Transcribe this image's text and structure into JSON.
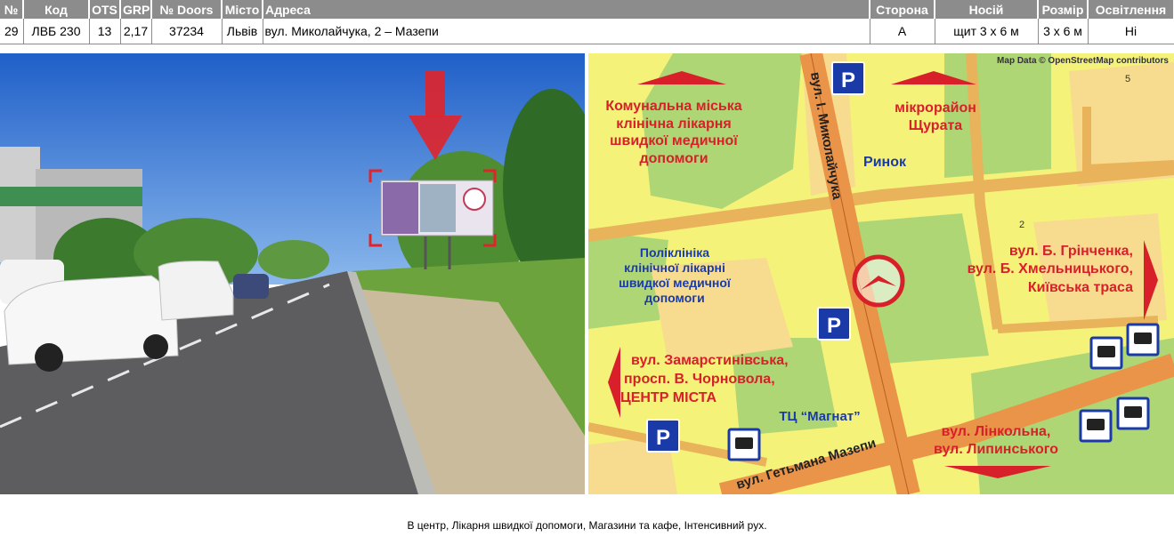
{
  "table": {
    "headers": [
      "№",
      "Код",
      "OTS",
      "GRP",
      "№ Doors",
      "Місто",
      "Адреса",
      "Сторона",
      "Носій",
      "Розмір",
      "Освітлення"
    ],
    "row": [
      "29",
      "ЛВБ 230",
      "13",
      "2,17",
      "37234",
      "Львів",
      "вул. Миколайчука, 2 – Мазепи",
      "A",
      "щит 3 х 6 м",
      "3 х 6 м",
      "Ні"
    ]
  },
  "map": {
    "attribution": "Map Data © OpenStreetMap contributors",
    "house_numbers": [
      "5",
      "2"
    ],
    "street_vertical": "вул. І. Миколайчука",
    "street_bottom": "вул. Гетьмана Мазепи",
    "labels": {
      "hospital": [
        "Комунальна міська",
        "клінічна лікарня",
        "швидкої медичної",
        "допомоги"
      ],
      "district": [
        "мікрорайон",
        "Щурата"
      ],
      "market": "Ринок",
      "clinic": [
        "Поліклініка",
        "клінічної лікарні",
        "швидкої медичної",
        "допомоги"
      ],
      "east": [
        "вул. Б. Грінченка,",
        "вул. Б. Хмельницького,",
        "Київська траса"
      ],
      "west": [
        "вул. Замарстинівська,",
        "просп. В. Чорновола,",
        "ЦЕНТР МІСТА"
      ],
      "mall": "ТЦ “Магнат”",
      "south": [
        "вул. Лінкольна,",
        "вул. Липинського"
      ]
    },
    "parking_label": "P",
    "colors": {
      "yellow": "#f4f279",
      "tan": "#f7dc8f",
      "green": "#aed675",
      "road": "#e99448",
      "red": "#d8202a",
      "blue": "#1a3aa8"
    }
  },
  "caption": "В центр, Лікарня швидкої допомоги, Магазини та кафе, Інтенсивний рух."
}
